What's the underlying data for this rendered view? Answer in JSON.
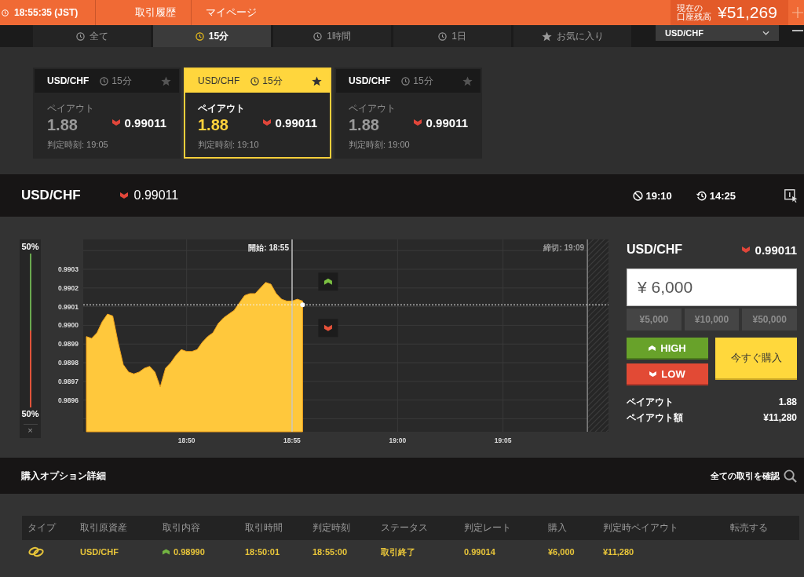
{
  "top_bar": {
    "clock": "18:55:35 (JST)",
    "links": [
      "取引履歴",
      "マイページ"
    ],
    "balance_label_lines": [
      "現在の",
      "口座残高"
    ],
    "balance": "¥51,269"
  },
  "period_tabs": [
    {
      "label": "全て",
      "kind": "period",
      "selected": false
    },
    {
      "label": "15分",
      "kind": "period",
      "selected": true
    },
    {
      "label": "1時間",
      "kind": "period",
      "selected": false
    },
    {
      "label": "1日",
      "kind": "period",
      "selected": false
    },
    {
      "label": "お気に入り",
      "kind": "favorites",
      "selected": false
    }
  ],
  "pair_select": {
    "value": "USD/CHF"
  },
  "option_cards": [
    {
      "pair": "USD/CHF",
      "period": "15分",
      "payout_label": "ペイアウト",
      "payout": "1.88",
      "rate_falling": true,
      "rate": "0.99011",
      "expiry": "判定時刻: 19:05",
      "selected": false
    },
    {
      "pair": "USD/CHF",
      "period": "15分",
      "payout_label": "ペイアウト",
      "payout": "1.88",
      "rate_falling": true,
      "rate": "0.99011",
      "expiry": "判定時刻: 19:10",
      "selected": true
    },
    {
      "pair": "USD/CHF",
      "period": "15分",
      "payout_label": "ペイアウト",
      "payout": "1.88",
      "rate_falling": true,
      "rate": "0.99011",
      "expiry": "判定時刻: 19:00",
      "selected": false
    }
  ],
  "chart_header": {
    "pair": "USD/CHF",
    "rate_falling": true,
    "rate": "0.99011",
    "expiry": "19:10",
    "remaining": "14:25"
  },
  "sentiment": {
    "high": "50%",
    "low": "50%",
    "level": 0.5,
    "close": "×"
  },
  "chart": {
    "deadline_label": "締切: 19:09",
    "chart_data": {
      "type": "area",
      "grid": true,
      "categories": [
        null,
        null,
        null,
        null,
        null,
        null,
        null,
        null,
        null,
        null,
        null,
        null,
        null,
        null,
        null,
        null,
        null,
        null,
        null,
        "18:50",
        null,
        null,
        null,
        null,
        null,
        null,
        null,
        null,
        null,
        null,
        null,
        null,
        null,
        null,
        null,
        null,
        null,
        null,
        null,
        "18:55",
        null,
        null,
        null,
        null,
        null,
        null,
        null,
        null,
        null,
        null,
        null,
        null,
        null,
        null,
        null,
        null,
        null,
        null,
        null,
        "19:00",
        null,
        null,
        null,
        null,
        null,
        null,
        null,
        null,
        null,
        null,
        null,
        null,
        null,
        null,
        null,
        null,
        null,
        null,
        null,
        "19:05",
        null,
        null,
        null,
        null,
        null,
        null,
        null,
        null,
        null,
        null,
        null,
        null,
        null,
        null,
        null,
        null,
        null,
        null,
        null,
        null
      ],
      "values": [
        0.98994,
        0.98993,
        0.98996,
        0.99002,
        0.99006,
        0.99005,
        0.98991,
        0.98979,
        0.98975,
        0.98974,
        0.98975,
        0.98977,
        0.98978,
        0.98975,
        0.98967,
        0.98977,
        0.9898,
        0.98984,
        0.98987,
        0.98986,
        0.98986,
        0.98987,
        0.98991,
        0.98994,
        0.98996,
        0.99001,
        0.99004,
        0.99006,
        0.99008,
        0.99012,
        0.99016,
        0.99017,
        0.99017,
        0.9902,
        0.99023,
        0.99022,
        0.99017,
        0.99014,
        0.99013,
        0.99013,
        0.99014,
        0.99013,
        null,
        null,
        null,
        null,
        null,
        null,
        null,
        null,
        null,
        null,
        null,
        null,
        null,
        null,
        null,
        null,
        null,
        null,
        null,
        null,
        null,
        null,
        null,
        null,
        null,
        null,
        null,
        null,
        null,
        null,
        null,
        null,
        null,
        null,
        null,
        null,
        null,
        null,
        null,
        null,
        null,
        null,
        null,
        null,
        null,
        null,
        null,
        null,
        null,
        null,
        null,
        null,
        null,
        null,
        null,
        null,
        null,
        null
      ],
      "ylim": [
        0.98943,
        0.99046
      ],
      "yticks": [
        {
          "value": 0.9896,
          "label": "0.9896"
        },
        {
          "value": 0.9897,
          "label": "0.9897"
        },
        {
          "value": 0.9898,
          "label": "0.9898"
        },
        {
          "value": 0.9899,
          "label": "0.9899"
        },
        {
          "value": 0.99,
          "label": "0.9900"
        },
        {
          "value": 0.9901,
          "label": "0.9901"
        },
        {
          "value": 0.9902,
          "label": "0.9902"
        },
        {
          "value": 0.9903,
          "label": "0.9903"
        }
      ],
      "ref_lines": [
        {
          "axis": "x",
          "value": "18:55",
          "label": "開始: 18:55"
        },
        {
          "axis": "y",
          "value": 0.99011
        }
      ]
    }
  },
  "order_panel": {
    "pair": "USD/CHF",
    "rate_falling": true,
    "rate": "0.99011",
    "amount": "¥ 6,000",
    "presets": [
      "¥5,000",
      "¥10,000",
      "¥50,000"
    ],
    "high_button": "HIGH",
    "low_button": "LOW",
    "buy_button": "今すぐ購入",
    "summary": [
      {
        "label": "ペイアウト",
        "value": "1.88"
      },
      {
        "label": "ペイアウト額",
        "value": "¥11,280"
      }
    ]
  },
  "positions": {
    "title": "購入オプション詳細",
    "view_all": "全ての取引を確認",
    "columns": [
      "タイプ",
      "取引原資産",
      "取引内容",
      "取引時間",
      "判定時刻",
      "ステータス",
      "判定レート",
      "購入",
      "判定時ペイアウト",
      "転売する"
    ],
    "rows": [
      {
        "asset": "USD/CHF",
        "high": true,
        "strike": "0.98990",
        "trade_time": "18:50:01",
        "expiry_time": "18:55:00",
        "status": "取引終了",
        "closing_rate": "0.99014",
        "purchase": "¥6,000",
        "payout": "¥11,280"
      }
    ]
  }
}
